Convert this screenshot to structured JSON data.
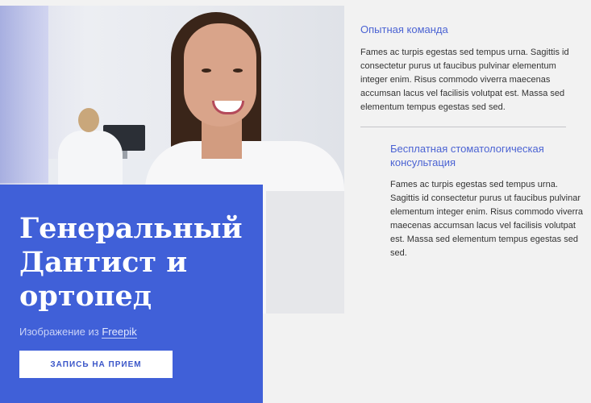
{
  "hero": {
    "title_line1": "Генеральный",
    "title_line2": "Дантист и",
    "title_line3": "ортопед",
    "credit_prefix": "Изображение из ",
    "credit_link": "Freepik",
    "cta_label": "ЗАПИСЬ НА ПРИЕМ"
  },
  "features": [
    {
      "title": "Опытная команда",
      "text": "Fames ac turpis egestas sed tempus urna. Sagittis id consectetur purus ut faucibus pulvinar elementum integer enim. Risus commodo viverra maecenas accumsan lacus vel facilisis volutpat est. Massa sed elementum tempus egestas sed sed."
    },
    {
      "title": "Бесплатная стоматологическая консультация",
      "text": "Fames ac turpis egestas sed tempus urna. Sagittis id consectetur purus ut faucibus pulvinar elementum integer enim. Risus commodo viverra maecenas accumsan lacus vel facilisis volutpat est. Massa sed elementum tempus egestas sed sed."
    }
  ],
  "colors": {
    "accent_blue": "#4060d8",
    "heading_blue": "#4b63d3",
    "background": "#f2f2f2"
  }
}
